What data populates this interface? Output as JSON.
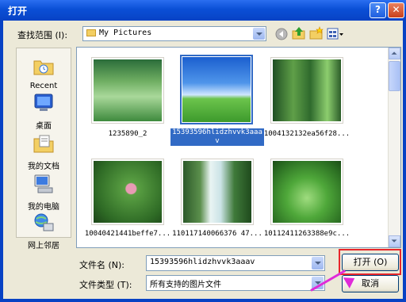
{
  "window": {
    "title": "打开",
    "help_glyph": "?",
    "close_glyph": "✕"
  },
  "look_in": {
    "label": "查找范围 (I):",
    "value": "My Pictures"
  },
  "places": [
    {
      "label": "Recent",
      "icon": "recent-folder-icon"
    },
    {
      "label": "桌面",
      "icon": "desktop-icon"
    },
    {
      "label": "我的文档",
      "icon": "my-documents-icon"
    },
    {
      "label": "我的电脑",
      "icon": "my-computer-icon"
    },
    {
      "label": "网上邻居",
      "icon": "network-places-icon"
    }
  ],
  "files": [
    {
      "name": "1235890_2",
      "selected": false
    },
    {
      "name": "15393596hlidzhvvk3aaav",
      "selected": true
    },
    {
      "name": "1004132132ea56f28...",
      "selected": false
    },
    {
      "name": "10040421441beffe7...",
      "selected": false
    },
    {
      "name": "110117140066376 47...",
      "selected": false
    },
    {
      "name": "10112411263388e9c...",
      "selected": false
    }
  ],
  "filename": {
    "label": "文件名 (N):",
    "value": "15393596hlidzhvvk3aaav"
  },
  "filetype": {
    "label": "文件类型 (T):",
    "value": "所有支持的图片文件"
  },
  "buttons": {
    "open": "打开 (O)",
    "cancel": "取消"
  },
  "colors": {
    "title_bar": "#0a4fd6",
    "selection": "#316ac5",
    "highlight_box": "#e8262b",
    "arrow": "#e02bd8"
  }
}
